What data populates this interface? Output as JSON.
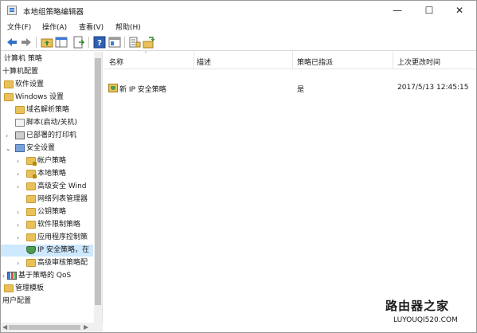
{
  "window": {
    "title": "本地组策略编辑器",
    "controls": {
      "minimize": "—",
      "maximize": "☐",
      "close": "✕"
    }
  },
  "menu": [
    "文件(F)",
    "操作(A)",
    "查看(V)",
    "帮助(H)"
  ],
  "toolbar_icons": [
    "back-arrow-icon",
    "forward-arrow-icon",
    "up-folder-icon",
    "show-hide-tree-icon",
    "export-list-icon",
    "help-icon",
    "properties-icon",
    "refresh-icon",
    "snap-icon"
  ],
  "tree": {
    "items": [
      {
        "label": "计算机 策略",
        "level": 0,
        "icon": "computer-icon"
      },
      {
        "label": "十算机配置",
        "level": 0,
        "icon": "none"
      },
      {
        "label": "软件设置",
        "level": 1,
        "icon": "folder-icon"
      },
      {
        "label": "Windows 设置",
        "level": 1,
        "icon": "folder-icon"
      },
      {
        "label": "域名解析策略",
        "level": 2,
        "icon": "folder-icon"
      },
      {
        "label": "脚本(启动/关机)",
        "level": 2,
        "icon": "script-icon"
      },
      {
        "label": "已部署的打印机",
        "level": 2,
        "icon": "printer-icon"
      },
      {
        "label": "安全设置",
        "level": 2,
        "icon": "security-icon"
      },
      {
        "label": "帐户策略",
        "level": 3,
        "icon": "lock-folder-icon"
      },
      {
        "label": "本地策略",
        "level": 3,
        "icon": "lock-folder-icon"
      },
      {
        "label": "高级安全 Wind",
        "level": 3,
        "icon": "folder-icon"
      },
      {
        "label": "网络列表管理器",
        "level": 3,
        "icon": "folder-icon"
      },
      {
        "label": "公钥策略",
        "level": 3,
        "icon": "folder-icon"
      },
      {
        "label": "软件限制策略",
        "level": 3,
        "icon": "folder-icon"
      },
      {
        "label": "应用程序控制策",
        "level": 3,
        "icon": "folder-icon"
      },
      {
        "label": "IP 安全策略，在",
        "level": 3,
        "icon": "shield-icon"
      },
      {
        "label": "高级审核策略配",
        "level": 3,
        "icon": "folder-icon"
      },
      {
        "label": "基于策略的 QoS",
        "level": 1,
        "icon": "chart-icon"
      },
      {
        "label": "管理模板",
        "level": 0,
        "icon": "folder-icon"
      },
      {
        "label": "用户配置",
        "level": 0,
        "icon": "none"
      }
    ]
  },
  "list": {
    "columns": [
      "名称",
      "描述",
      "策略已指派",
      "上次更改时间"
    ],
    "rows": [
      {
        "name": "新 IP 安全策略",
        "description": "",
        "assigned": "是",
        "modified": "2017/5/13 12:45:15"
      }
    ]
  },
  "watermark": {
    "title": "路由器之家",
    "url": "LUYOUQI520.COM"
  }
}
